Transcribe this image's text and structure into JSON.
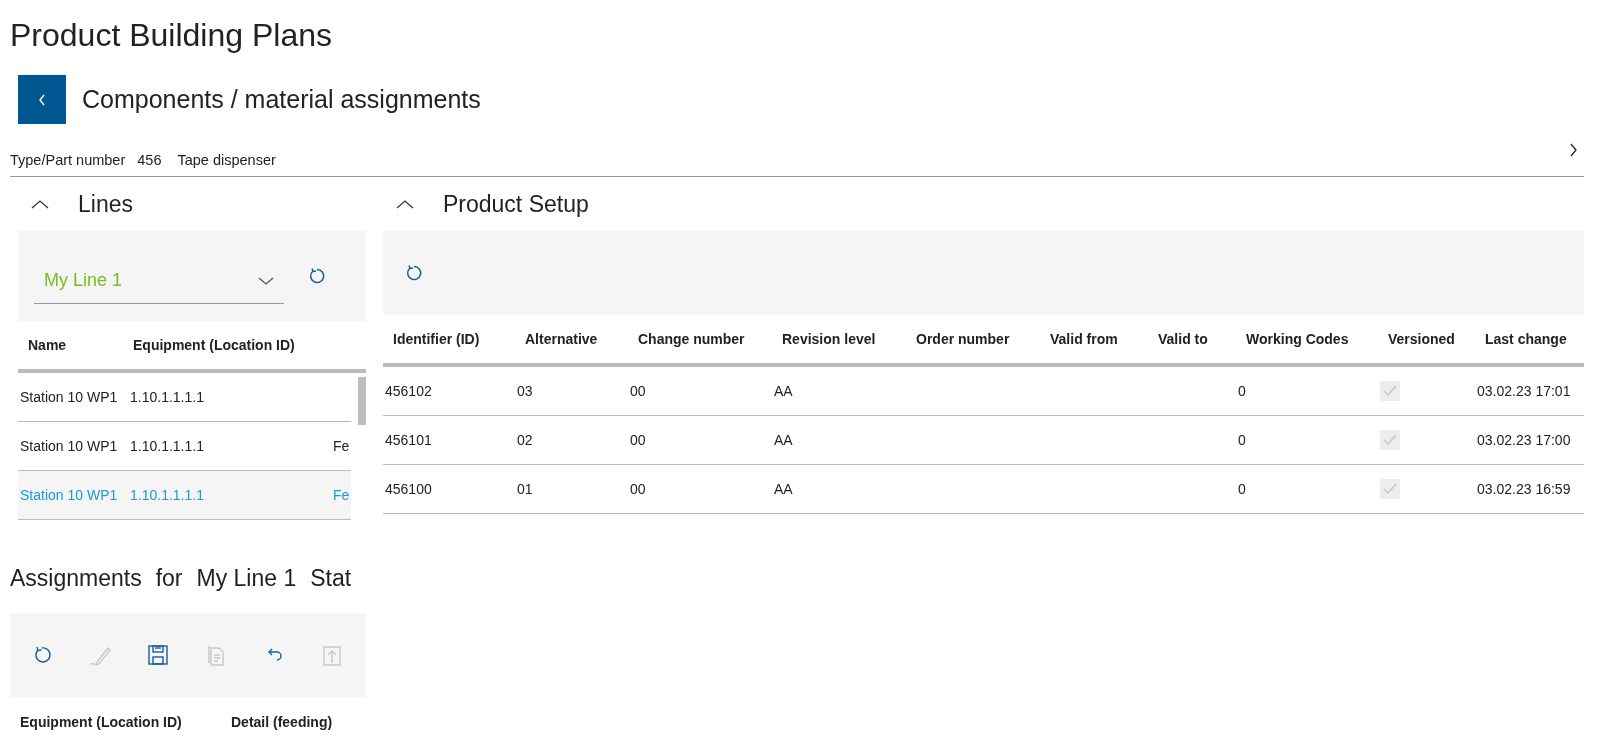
{
  "page": {
    "title": "Product Building Plans"
  },
  "header": {
    "subtitle": "Components / material assignments"
  },
  "part_info": {
    "label": "Type/Part number",
    "number": "456",
    "description": "Tape dispenser"
  },
  "lines": {
    "title": "Lines",
    "expanded": true,
    "line_select": {
      "value": "My Line 1"
    },
    "table": {
      "columns": [
        "Name",
        "Equipment (Location ID)"
      ],
      "rows": [
        {
          "name": "Station 10 WP1",
          "equipment": "1.10.1.1.1.1",
          "selected": false
        },
        {
          "name": "Station 10 WP1",
          "equipment": "1.10.1.1.1.1",
          "column_3": "Fe",
          "selected": false
        },
        {
          "name": "Station 10 WP1",
          "equipment": "1.10.1.1.1.1",
          "column_3": "Fe",
          "selected": true
        }
      ]
    }
  },
  "assignments": {
    "title": "Assignments",
    "for": "for",
    "line": "My Line 1",
    "station": "Stat",
    "toolbar": [
      {
        "kind": "refresh",
        "disabled": false
      },
      {
        "kind": "edit",
        "disabled": true
      },
      {
        "kind": "save",
        "disabled": false
      },
      {
        "kind": "copy",
        "disabled": true
      },
      {
        "kind": "undo",
        "disabled": false
      },
      {
        "kind": "upload",
        "disabled": true
      }
    ],
    "table": {
      "columns": [
        "Equipment (Location ID)",
        "Detail (feeding)"
      ]
    }
  },
  "product_setup": {
    "title": "Product Setup",
    "expanded": true,
    "table": {
      "columns": [
        "Identifier (ID)",
        "Alternative",
        "Change number",
        "Revision level",
        "Order number",
        "Valid from",
        "Valid to",
        "Working Codes",
        "Versioned",
        "Last change"
      ],
      "rows": [
        {
          "id": "456102",
          "alternative": "03",
          "change_number": "00",
          "revision_level": "AA",
          "working_codes": "0",
          "versioned": true,
          "last_change": "03.02.23 17:01"
        },
        {
          "id": "456101",
          "alternative": "02",
          "change_number": "00",
          "revision_level": "AA",
          "working_codes": "0",
          "versioned": true,
          "last_change": "03.02.23 17:00"
        },
        {
          "id": "456100",
          "alternative": "01",
          "change_number": "00",
          "revision_level": "AA",
          "working_codes": "0",
          "versioned": true,
          "last_change": "03.02.23 16:59"
        }
      ]
    }
  }
}
